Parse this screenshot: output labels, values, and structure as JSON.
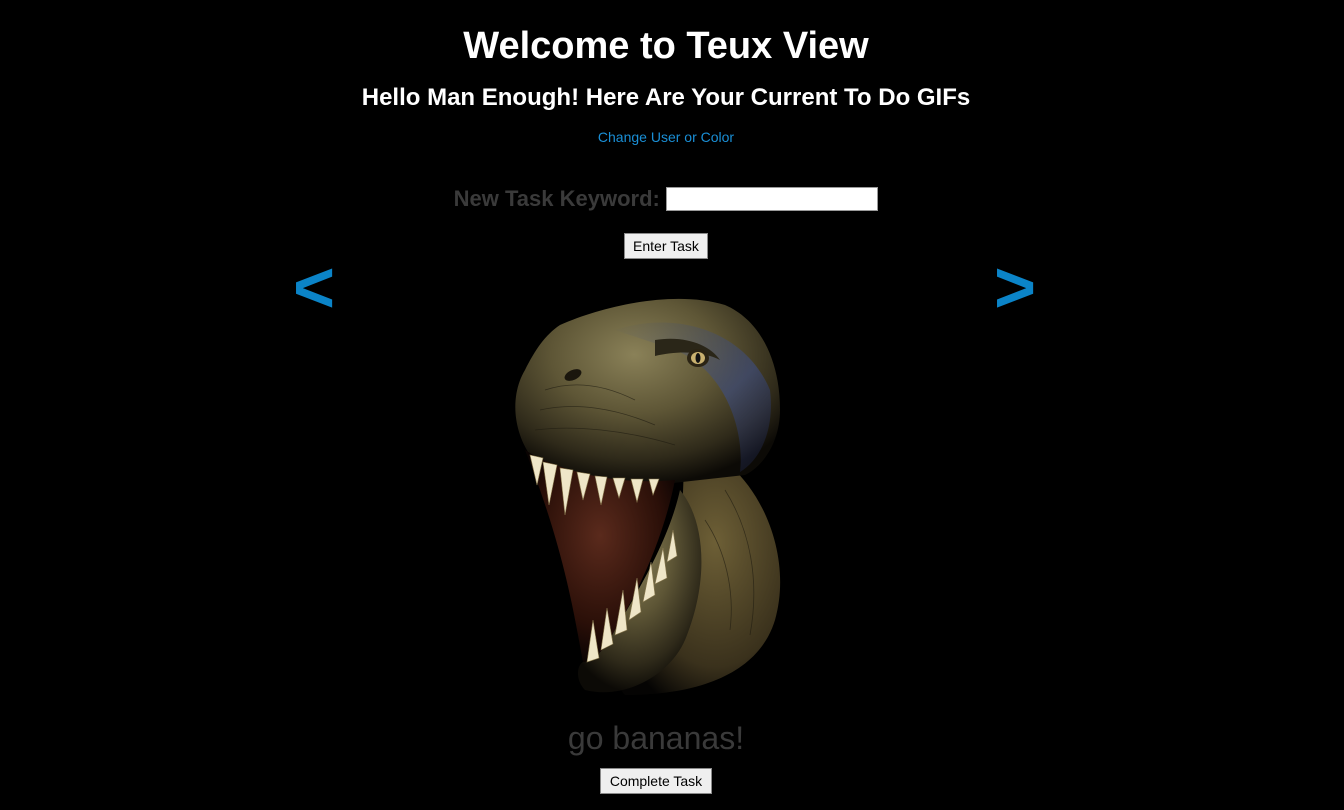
{
  "header": {
    "title": "Welcome to Teux View",
    "subtitle": "Hello Man Enough! Here Are Your Current To Do GIFs",
    "change_link": "Change User or Color"
  },
  "task_form": {
    "label": "New Task Keyword:",
    "input_value": "",
    "submit_label": "Enter Task"
  },
  "carousel": {
    "prev_label": "<",
    "next_label": ">",
    "gif_subject": "t-rex-roaring",
    "task_caption": "go bananas!",
    "complete_label": "Complete Task"
  },
  "colors": {
    "background": "#000000",
    "accent": "#0b84c8",
    "link": "#1a8fd6",
    "muted_text": "#3a3a3a"
  }
}
